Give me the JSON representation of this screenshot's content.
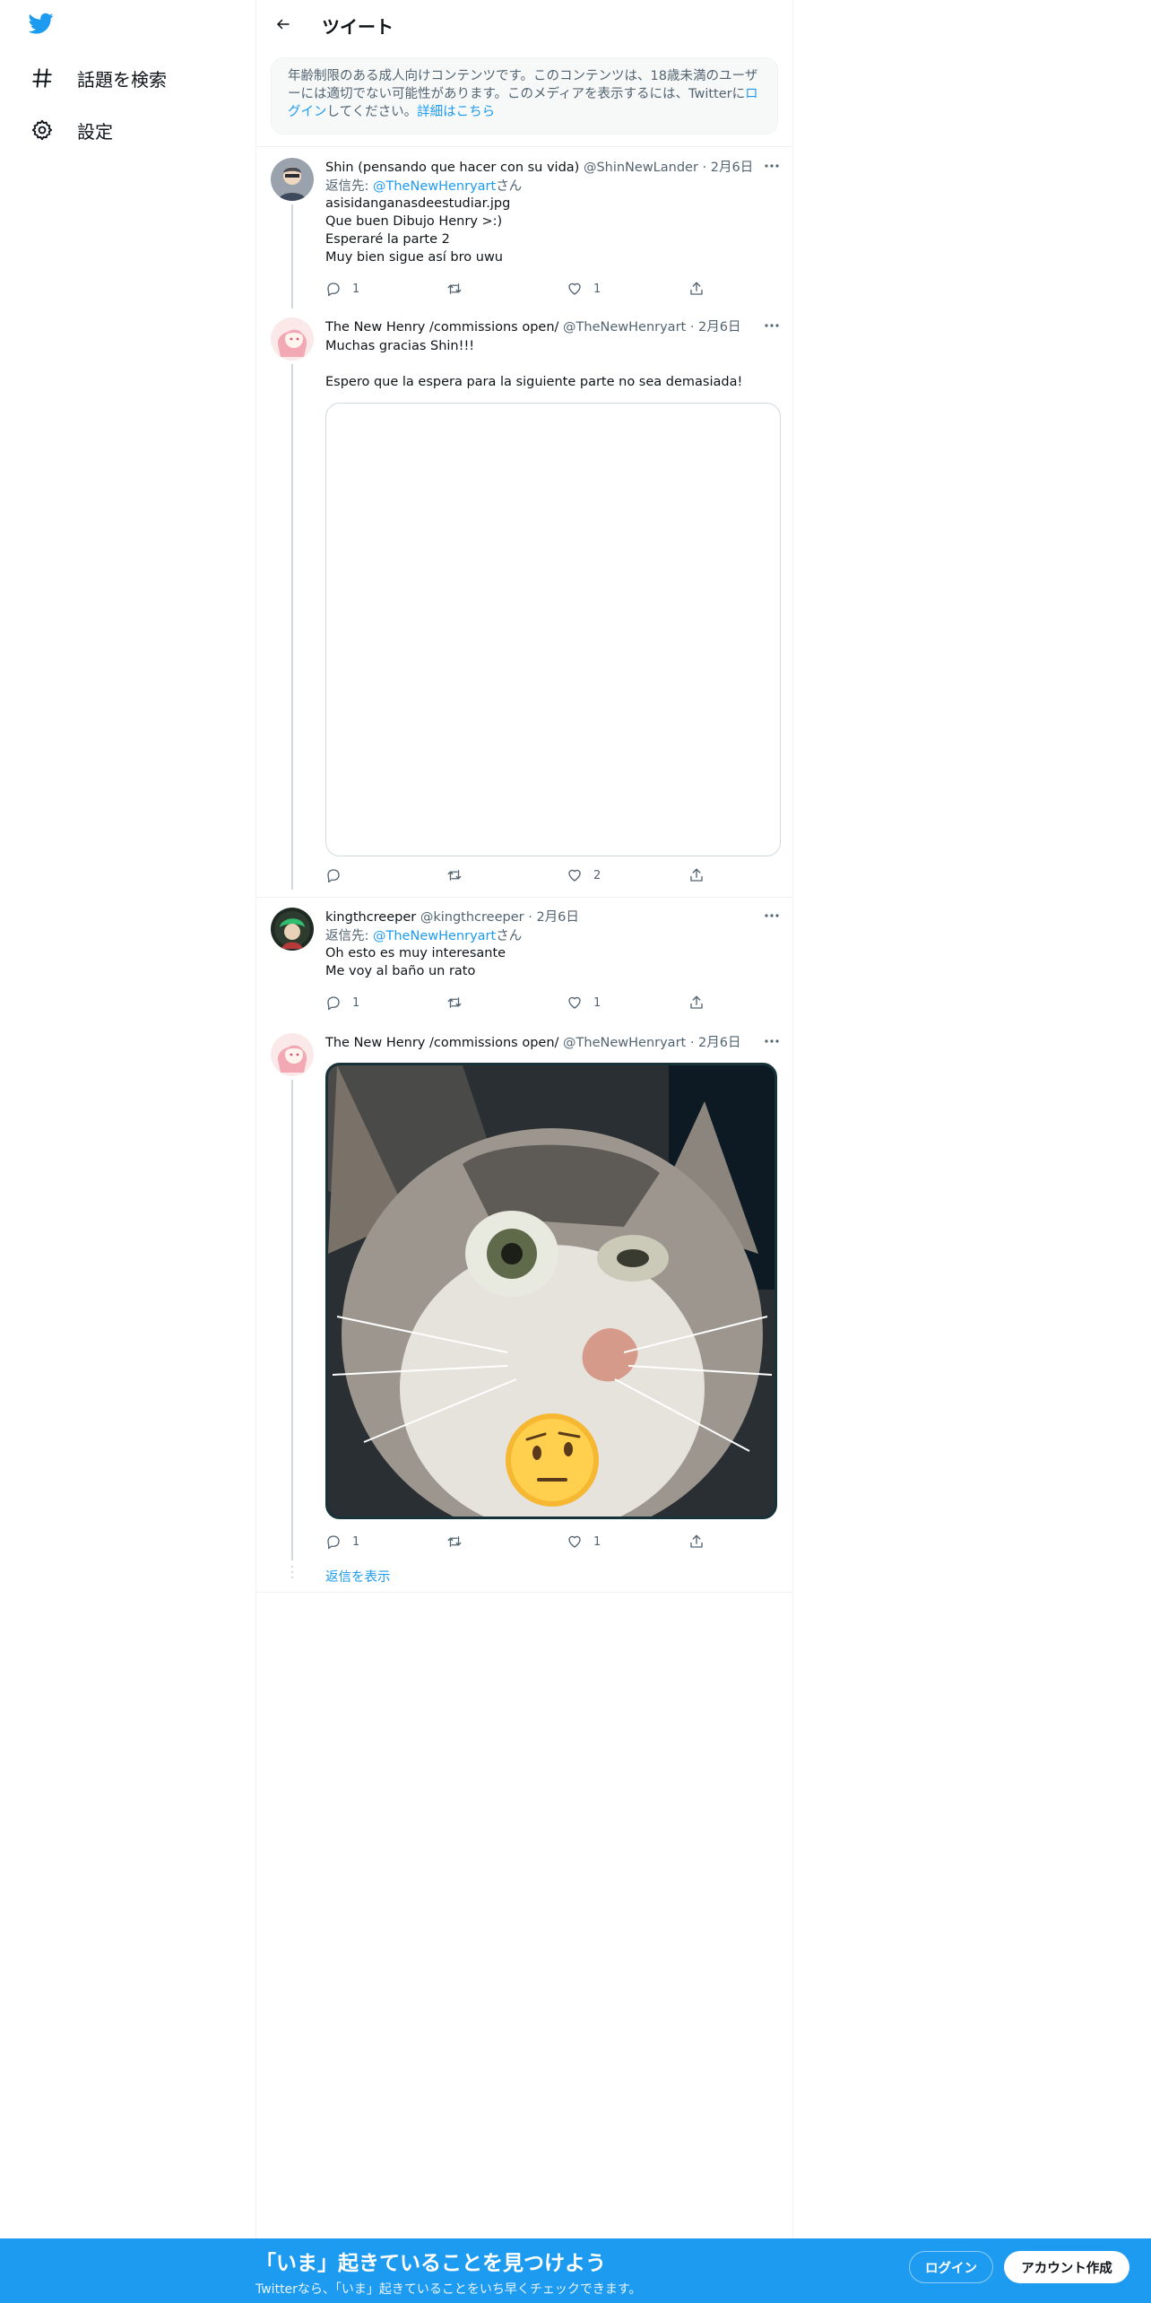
{
  "header": {
    "title": "ツイート"
  },
  "sidebar": {
    "items": [
      {
        "label": "話題を検索",
        "icon": "hashtag-icon"
      },
      {
        "label": "設定",
        "icon": "gear-icon"
      }
    ]
  },
  "notice": {
    "text_before": "年齢制限のある成人向けコンテンツです。このコンテンツは、18歳未満のユーザーには適切でない可能性があります。このメディアを表示するには、Twitterに",
    "login_link": "ログイン",
    "text_middle": "してください。",
    "details_link": "詳細はこちら"
  },
  "tweets": [
    {
      "name": "Shin (pensando que hacer con su vida)",
      "handle": "@ShinNewLander",
      "dot": "·",
      "date": "2月6日",
      "reply_prefix": "返信先: ",
      "reply_to": "@TheNewHenryart",
      "reply_suffix": "さん",
      "text": "asisidanganasdeestudiar.jpg\nQue buen Dibujo Henry >:)\nEsperaré la parte 2\nMuy bien sigue así bro uwu",
      "replies": "1",
      "retweets": "",
      "likes": "1"
    },
    {
      "name": "The New Henry /commissions open/",
      "handle": "@TheNewHenryart",
      "dot": "·",
      "date": "2月6日",
      "text": "Muchas gracias Shin!!!\n\nEspero que la espera para la siguiente parte no sea demasiada!",
      "replies": "",
      "retweets": "",
      "likes": "2"
    },
    {
      "name": "kingthcreeper",
      "handle": "@kingthcreeper",
      "dot": "·",
      "date": "2月6日",
      "reply_prefix": "返信先: ",
      "reply_to": "@TheNewHenryart",
      "reply_suffix": "さん",
      "text": "Oh esto es muy interesante\nMe voy al baño un rato",
      "replies": "1",
      "retweets": "",
      "likes": "1"
    },
    {
      "name": "The New Henry /commissions open/",
      "handle": "@TheNewHenryart",
      "dot": "·",
      "date": "2月6日",
      "replies": "1",
      "retweets": "",
      "likes": "1"
    }
  ],
  "show_replies": "返信を表示",
  "bottom_bar": {
    "title": "「いま」起きていることを見つけよう",
    "subtitle": "Twitterなら、「いま」起きていることをいち早くチェックできます。",
    "login": "ログイン",
    "signup": "アカウント作成"
  },
  "colors": {
    "accent": "#1d9bf0",
    "secondary_text": "#536471",
    "border": "#eff3f4"
  }
}
